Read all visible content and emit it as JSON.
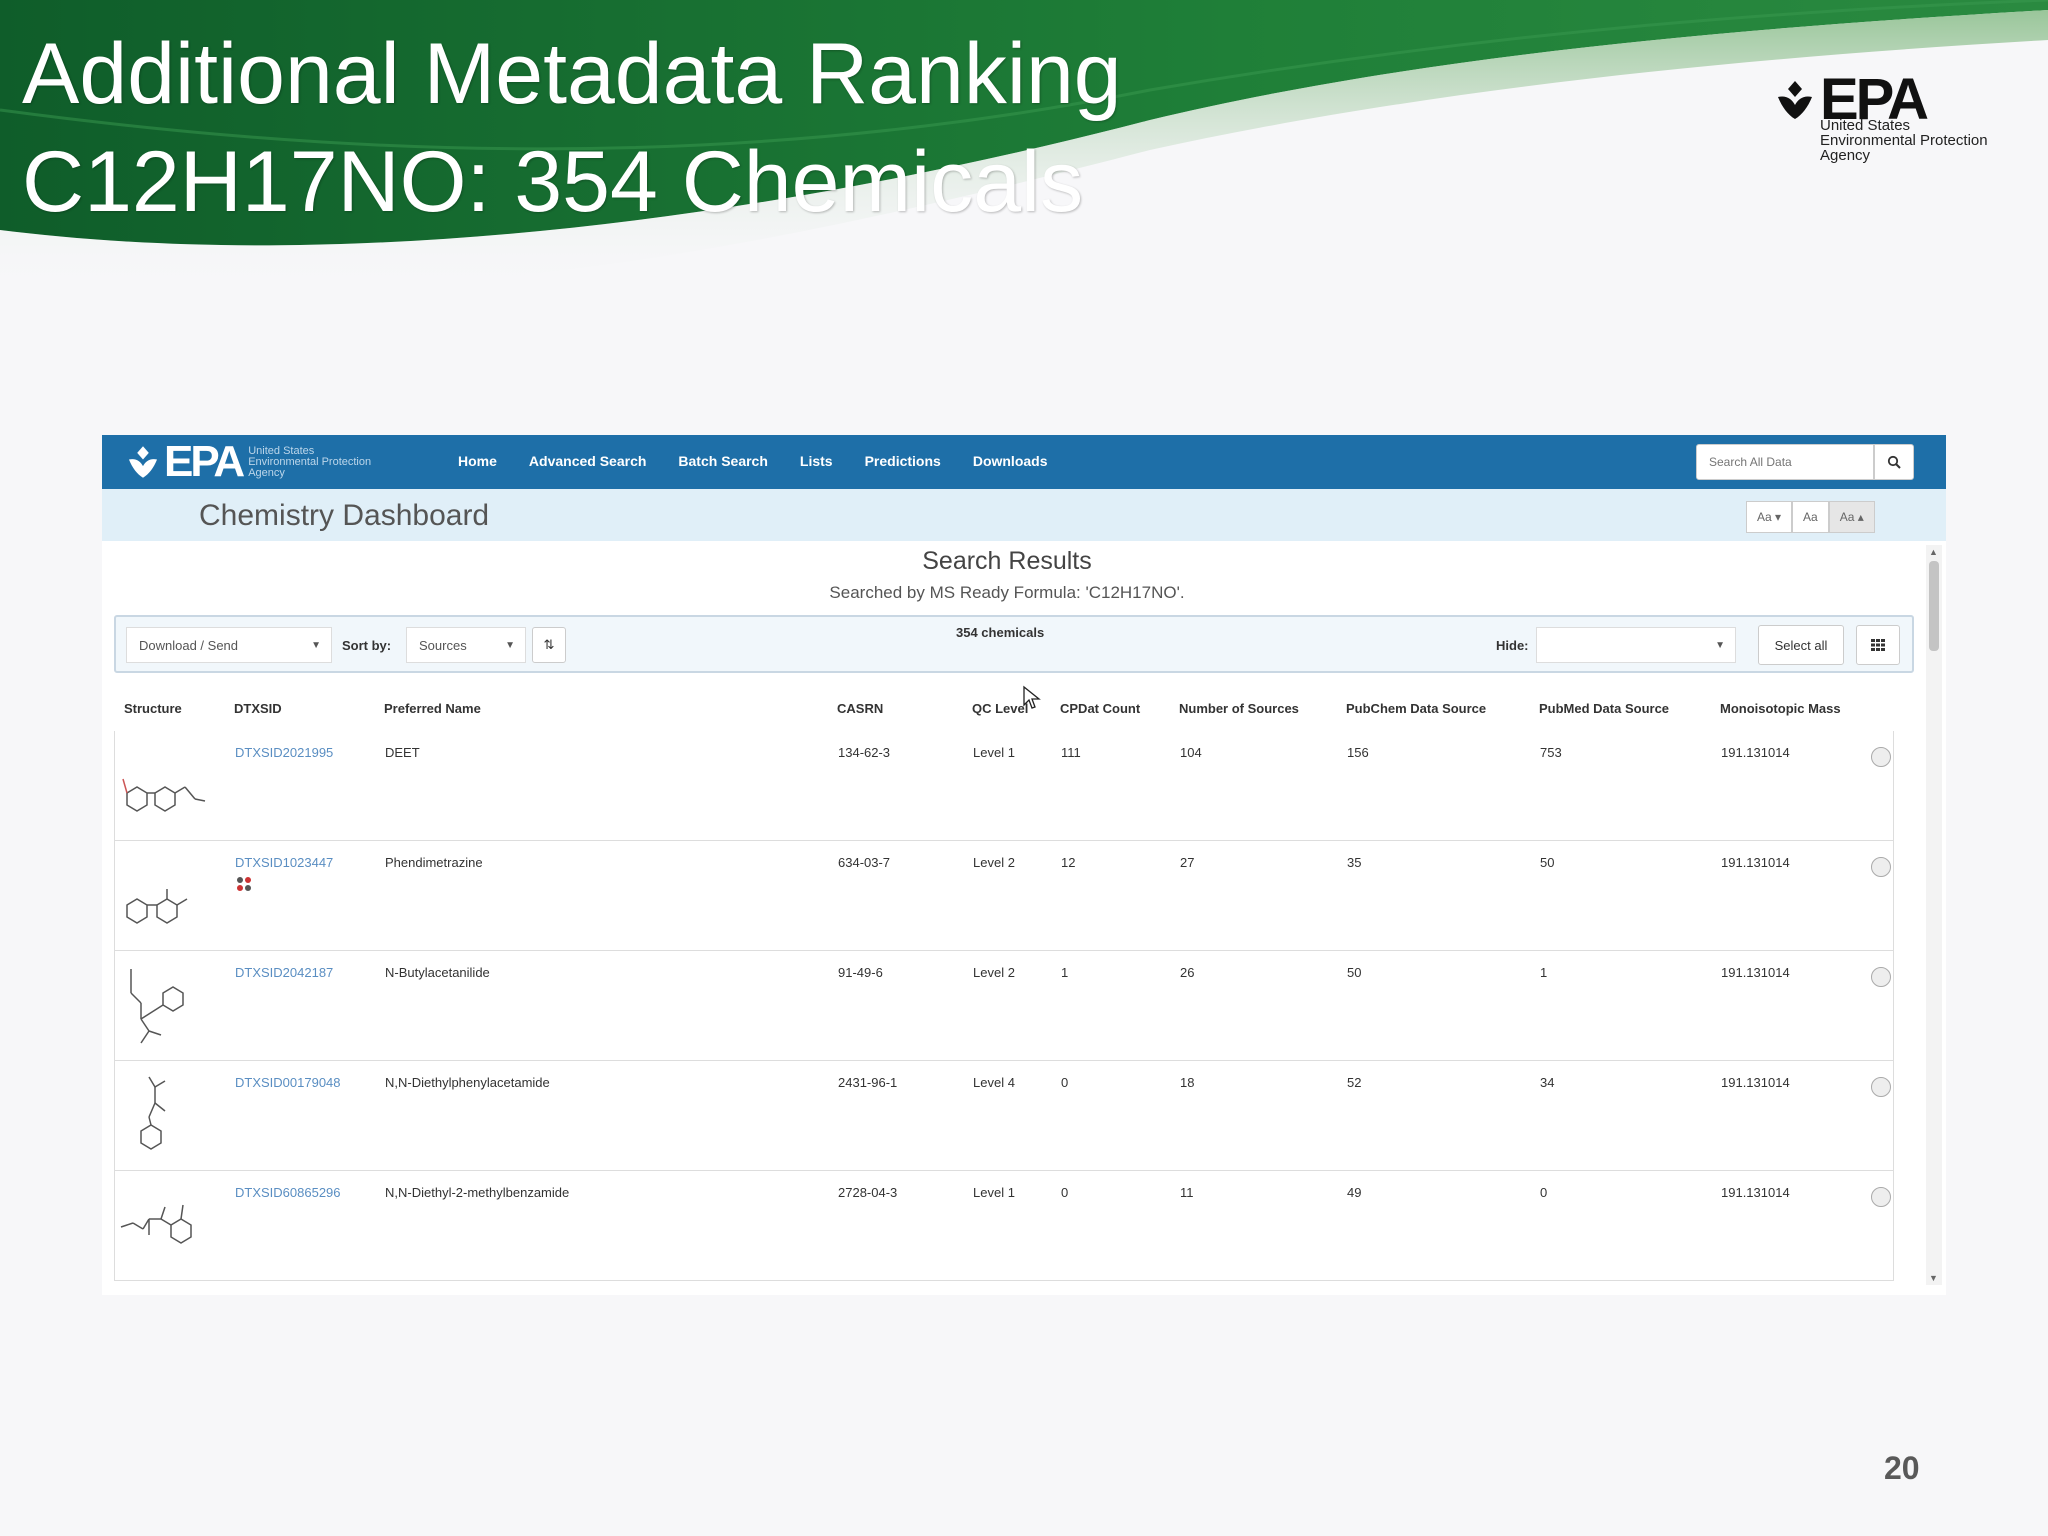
{
  "slide": {
    "title_line1": "Additional Metadata Ranking",
    "title_line2": "C12H17NO: 354 Chemicals",
    "page_number": "20",
    "logo": {
      "word": "EPA",
      "line1": "United States",
      "line2": "Environmental Protection",
      "line3": "Agency"
    },
    "colors": {
      "banner_dark": "#0f5d2a",
      "banner_mid": "#1f7f38",
      "banner_light": "#6aa86f"
    }
  },
  "dashboard": {
    "nav": {
      "logo_word": "EPA",
      "logo_line1": "United States",
      "logo_line2": "Environmental Protection",
      "logo_line3": "Agency",
      "links": [
        "Home",
        "Advanced Search",
        "Batch Search",
        "Lists",
        "Predictions",
        "Downloads"
      ],
      "search_placeholder": "Search All Data",
      "search_icon": "search-icon"
    },
    "title": "Chemistry Dashboard",
    "font_buttons": [
      "Aa ▾",
      "Aa",
      "Aa ▴"
    ],
    "results_heading": "Search Results",
    "results_sub": "Searched by MS Ready Formula: 'C12H17NO'.",
    "toolbar": {
      "download_label": "Download / Send",
      "sort_label": "Sort by:",
      "sort_value": "Sources",
      "sort_dir": "⇅",
      "count": "354 chemicals",
      "hide_label": "Hide:",
      "select_all": "Select all"
    },
    "columns": [
      "Structure",
      "DTXSID",
      "Preferred Name",
      "CASRN",
      "QC Level",
      "CPDat Count",
      "Number of Sources",
      "PubChem Data Source",
      "PubMed Data Source",
      "Monoisotopic Mass"
    ],
    "rows": [
      {
        "dtxsid": "DTXSID2021995",
        "name": "DEET",
        "casrn": "134-62-3",
        "qc": "Level 1",
        "cpdat": "111",
        "sources": "104",
        "pubchem": "156",
        "pubmed": "753",
        "mass": "191.131014"
      },
      {
        "dtxsid": "DTXSID1023447",
        "name": "Phendimetrazine",
        "casrn": "634-03-7",
        "qc": "Level 2",
        "cpdat": "12",
        "sources": "27",
        "pubchem": "35",
        "pubmed": "50",
        "mass": "191.131014"
      },
      {
        "dtxsid": "DTXSID2042187",
        "name": "N-Butylacetanilide",
        "casrn": "91-49-6",
        "qc": "Level 2",
        "cpdat": "1",
        "sources": "26",
        "pubchem": "50",
        "pubmed": "1",
        "mass": "191.131014"
      },
      {
        "dtxsid": "DTXSID00179048",
        "name": "N,N-Diethylphenylacetamide",
        "casrn": "2431-96-1",
        "qc": "Level 4",
        "cpdat": "0",
        "sources": "18",
        "pubchem": "52",
        "pubmed": "34",
        "mass": "191.131014"
      },
      {
        "dtxsid": "DTXSID60865296",
        "name": "N,N-Diethyl-2-methylbenzamide",
        "casrn": "2728-04-3",
        "qc": "Level 1",
        "cpdat": "0",
        "sources": "11",
        "pubchem": "49",
        "pubmed": "0",
        "mass": "191.131014"
      }
    ]
  }
}
